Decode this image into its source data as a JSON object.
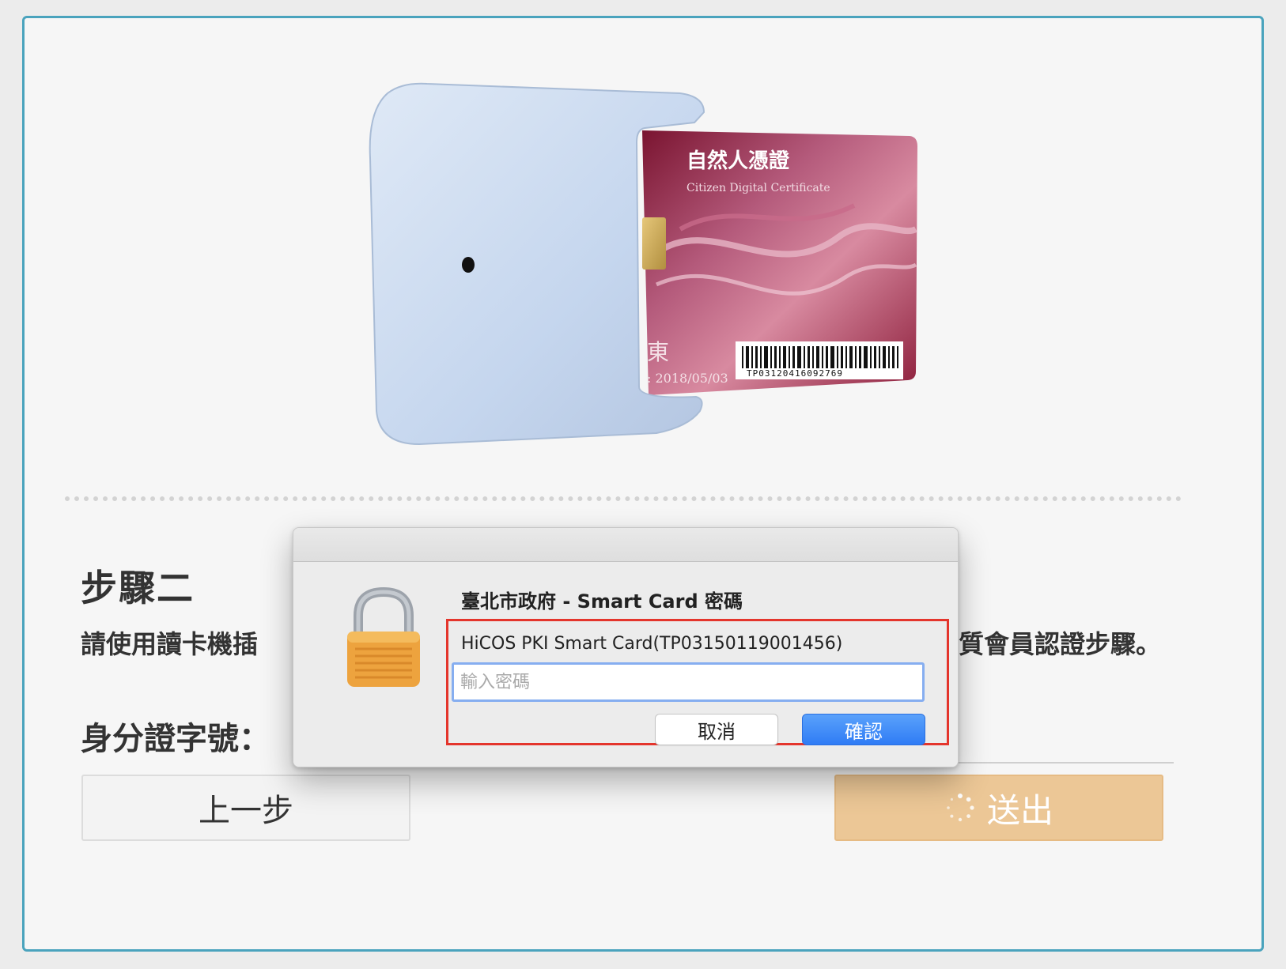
{
  "illustration": {
    "card_title": "自然人憑證",
    "card_subtitle": "Citizen Digital Certificate",
    "card_name_char": "東",
    "card_date": ": 2018/05/03",
    "card_barcode_text": "TP03120416092769"
  },
  "step": {
    "title": "步驟二",
    "instruction_left": "請使用讀卡機插",
    "instruction_right": "質會員認證步驟。",
    "id_label": "身分證字號："
  },
  "buttons": {
    "prev_label": "上一步",
    "submit_label": "送出"
  },
  "dialog": {
    "heading": "臺北市政府 - Smart Card 密碼",
    "card_name": "HiCOS PKI Smart Card(TP03150119001456)",
    "password_placeholder": "輸入密碼",
    "password_value": "",
    "cancel_label": "取消",
    "confirm_label": "確認"
  },
  "colors": {
    "frame_border": "#4aa3bd",
    "submit_bg": "#ecc796",
    "confirm_bg": "#2f7cf5",
    "highlight_border": "#e4352c"
  }
}
